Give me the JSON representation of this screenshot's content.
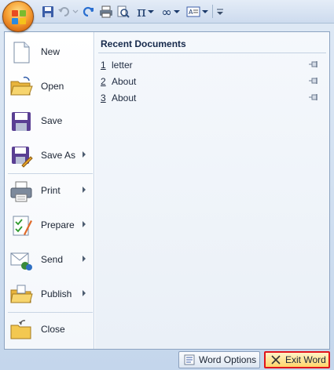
{
  "qat": {
    "icons": [
      "office-button",
      "save-icon",
      "undo-icon",
      "redo-icon",
      "print-icon",
      "print-preview-icon",
      "equation-icon",
      "infinity-icon",
      "text-box-icon",
      "customize-toolbar-icon"
    ]
  },
  "menu": {
    "items": [
      {
        "label": "New",
        "icon": "new-document-icon",
        "has_submenu": false
      },
      {
        "label": "Open",
        "icon": "open-folder-icon",
        "has_submenu": false
      },
      {
        "label": "Save",
        "icon": "save-icon",
        "has_submenu": false
      },
      {
        "label": "Save As",
        "icon": "save-as-icon",
        "has_submenu": true
      },
      {
        "label": "Print",
        "icon": "printer-icon",
        "has_submenu": true
      },
      {
        "label": "Prepare",
        "icon": "prepare-icon",
        "has_submenu": true
      },
      {
        "label": "Send",
        "icon": "send-icon",
        "has_submenu": true
      },
      {
        "label": "Publish",
        "icon": "publish-icon",
        "has_submenu": true
      },
      {
        "label": "Close",
        "icon": "close-folder-icon",
        "has_submenu": false
      }
    ]
  },
  "recent": {
    "title": "Recent Documents",
    "documents": [
      {
        "num": "1",
        "name": "letter"
      },
      {
        "num": "2",
        "name": "About"
      },
      {
        "num": "3",
        "name": "About"
      }
    ]
  },
  "footer": {
    "options_label": "Word Options",
    "exit_label": "Exit Word"
  },
  "colors": {
    "office_button": "#f39a2c",
    "exit_highlight": "#e0141b"
  }
}
